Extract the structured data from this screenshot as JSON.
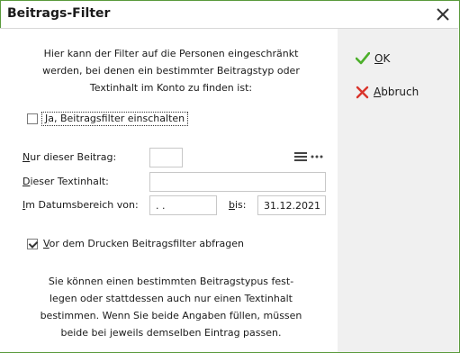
{
  "window": {
    "title": "Beitrags-Filter"
  },
  "intro": {
    "line1": "Hier kann der Filter auf die Personen eingeschränkt",
    "line2": "werden, bei denen ein bestimmter Beitragstyp oder",
    "line3": "Textinhalt im Konto zu finden ist:"
  },
  "enable_filter": {
    "accel": "J",
    "rest": "a, Beitragsfilter einschalten",
    "checked": false
  },
  "fields": {
    "beitrag_label": {
      "accel": "N",
      "rest": "ur dieser Beitrag:"
    },
    "beitrag_value": "",
    "text_label": {
      "accel": "D",
      "rest": "ieser Textinhalt:"
    },
    "text_value": "",
    "date_label": {
      "accel": "I",
      "rest": "m Datumsbereich von:"
    },
    "date_from": " .  .",
    "bis_label": {
      "accel": "b",
      "rest": "is:"
    },
    "date_to": "31.12.2021"
  },
  "ask_before_print": {
    "accel": "V",
    "rest": "or dem Drucken Beitragsfilter abfragen",
    "checked": true
  },
  "note": {
    "line1": "Sie können einen bestimmten Beitragstypus fest-",
    "line2": "legen oder stattdessen auch nur einen Textinhalt",
    "line3": "bestimmen. Wenn Sie beide Angaben füllen, müssen",
    "line4": "beide bei jeweils demselben Eintrag passen."
  },
  "buttons": {
    "ok": {
      "accel": "O",
      "rest": "K"
    },
    "abbruch": {
      "accel": "A",
      "rest": "bbruch"
    }
  },
  "icons": {
    "ok": "checkmark-icon",
    "abbruch": "cross-icon",
    "close": "close-icon",
    "list": "list-icon",
    "more": "more-dots-icon"
  },
  "colors": {
    "ok_green": "#4caf2a",
    "cancel_red": "#d9342b",
    "border_green": "#5a9a3c"
  }
}
